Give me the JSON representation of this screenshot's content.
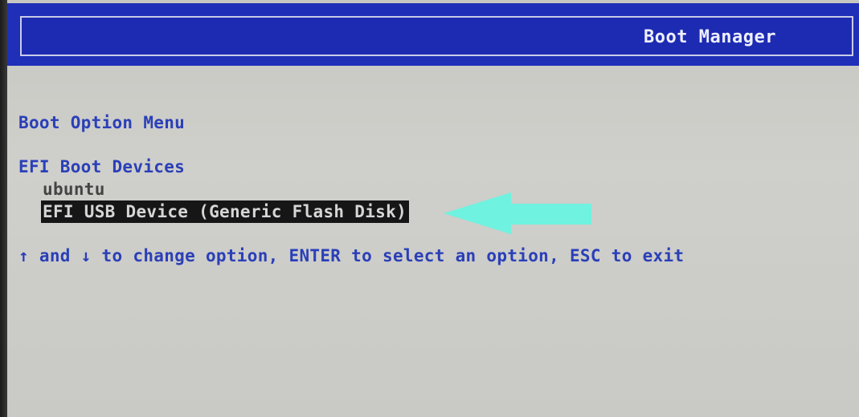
{
  "header": {
    "title": "Boot Manager"
  },
  "menu": {
    "title": "Boot Option Menu",
    "section_label": "EFI Boot Devices",
    "items": [
      {
        "label": "ubuntu",
        "selected": false
      },
      {
        "label": "EFI USB Device (Generic Flash Disk)",
        "selected": true
      }
    ]
  },
  "help": {
    "text": "↑ and ↓ to change option, ENTER to select an option, ESC to exit"
  },
  "annotation": {
    "arrow_icon": "arrow-left-icon",
    "arrow_color": "#6ff2e0"
  },
  "colors": {
    "header_bg": "#1f2fb8",
    "text_blue": "#2a3fb8",
    "screen_bg": "#cbcbc7",
    "selection_bg": "#161616"
  }
}
